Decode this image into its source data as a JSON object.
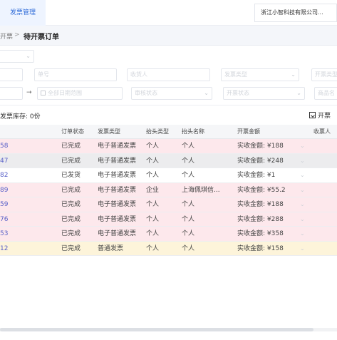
{
  "header": {
    "tab_label": "发票管理",
    "company_name": "浙江小智科技有限公司..."
  },
  "breadcrumb": {
    "parent": "开票",
    "separator": ">",
    "current": "待开票订单"
  },
  "filters": {
    "row1": [
      "单号",
      "收货人",
      "发票类型",
      "开票类型"
    ],
    "row2_date": "全部日期范围",
    "row2": [
      "审核状态",
      "开票状态",
      "商品名"
    ]
  },
  "toolbar": {
    "stock_label": "发票库存:",
    "stock_value": "0份",
    "export_label": "开票"
  },
  "table": {
    "columns": [
      "订单状态",
      "发票类型",
      "抬头类型",
      "抬头名称",
      "开票金额",
      "收票人"
    ],
    "rows": [
      {
        "id": "58",
        "status": "已完成",
        "type": "电子普通发票",
        "htype": "个人",
        "hname": "个人",
        "amount": "实收金额: ¥188",
        "bg": "#fde8ec"
      },
      {
        "id": "47",
        "status": "已完成",
        "type": "电子普通发票",
        "htype": "个人",
        "hname": "个人",
        "amount": "实收金额: ¥248",
        "bg": "#ececee"
      },
      {
        "id": "82",
        "status": "已发货",
        "type": "电子普通发票",
        "htype": "个人",
        "hname": "个人",
        "amount": "实收金额: ¥1",
        "bg": "#ffffff"
      },
      {
        "id": "89",
        "status": "已完成",
        "type": "电子普通发票",
        "htype": "企业",
        "hname": "上海佩琪信...",
        "amount": "实收金额: ¥55.2",
        "bg": "#fde8ec"
      },
      {
        "id": "59",
        "status": "已完成",
        "type": "电子普通发票",
        "htype": "个人",
        "hname": "个人",
        "amount": "实收金额: ¥188",
        "bg": "#fde8ec"
      },
      {
        "id": "76",
        "status": "已完成",
        "type": "电子普通发票",
        "htype": "个人",
        "hname": "个人",
        "amount": "实收金额: ¥288",
        "bg": "#fde8ec"
      },
      {
        "id": "53",
        "status": "已完成",
        "type": "电子普通发票",
        "htype": "个人",
        "hname": "个人",
        "amount": "实收金额: ¥358",
        "bg": "#fde8ec"
      },
      {
        "id": "12",
        "status": "已完成",
        "type": "普通发票",
        "htype": "个人",
        "hname": "个人",
        "amount": "实收金额: ¥158",
        "bg": "#fdf4da"
      }
    ]
  }
}
